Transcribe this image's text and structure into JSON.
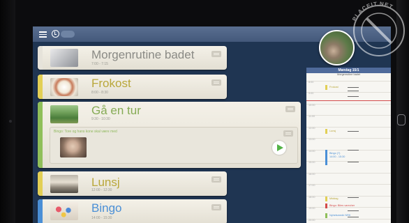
{
  "topbar": {
    "menu_icon": "menu-icon",
    "clock_icon": "clock-icon"
  },
  "activities": [
    {
      "title": "Morgenrutine badet",
      "time": "7:00 - 7:15",
      "color": "#e6e3da",
      "title_color": "#8a8a85"
    },
    {
      "title": "Frokost",
      "time": "8:00 - 8:30",
      "color": "#e2cf55",
      "title_color": "#b9a73a"
    },
    {
      "title": "Gå en tur",
      "time": "9:30 - 10:30",
      "color": "#8fbf5a",
      "title_color": "#86ab55",
      "expanded": true,
      "description": "Bingo: Tore og hans kone skal være med"
    },
    {
      "title": "Lunsj",
      "time": "12:00 - 12:30",
      "color": "#e2cf55",
      "title_color": "#b9a73a"
    },
    {
      "title": "Bingo",
      "time": "14:00 - 15:30",
      "color": "#4a8fd6",
      "title_color": "#4a8fd6"
    }
  ],
  "calendar": {
    "header": "Mandag 15/1",
    "subheader": "Morgenrutine badet",
    "hours": [
      "8:00",
      "9:00",
      "10:00",
      "11:00",
      "12:00",
      "13:00",
      "14:00",
      "15:00",
      "16:00",
      "17:00",
      "18:00",
      "19:00",
      "20:00"
    ],
    "events": [
      {
        "label": "Frokost",
        "color": "#e2cf55"
      },
      {
        "label": "Lunsj",
        "color": "#e2cf55"
      },
      {
        "label": "Bingo (?)",
        "color": "#4a8fd6"
      },
      {
        "label": "14:00 - 15:30",
        "color": "#4a8fd6"
      },
      {
        "label": "Middag",
        "color": "#e2cf55"
      },
      {
        "label": "Bingo: Bilen.varecher",
        "color": "#d34a4a"
      },
      {
        "label": "Nyhetsmedir NRK",
        "color": "#8fbf5a"
      }
    ]
  },
  "watermark": {
    "text": "PLACEIT.NET"
  },
  "colors": {
    "screen_bg": "#1f3552",
    "topbar": "#4f6487",
    "accent_green": "#54b347",
    "now_line": "#d34a4a"
  }
}
